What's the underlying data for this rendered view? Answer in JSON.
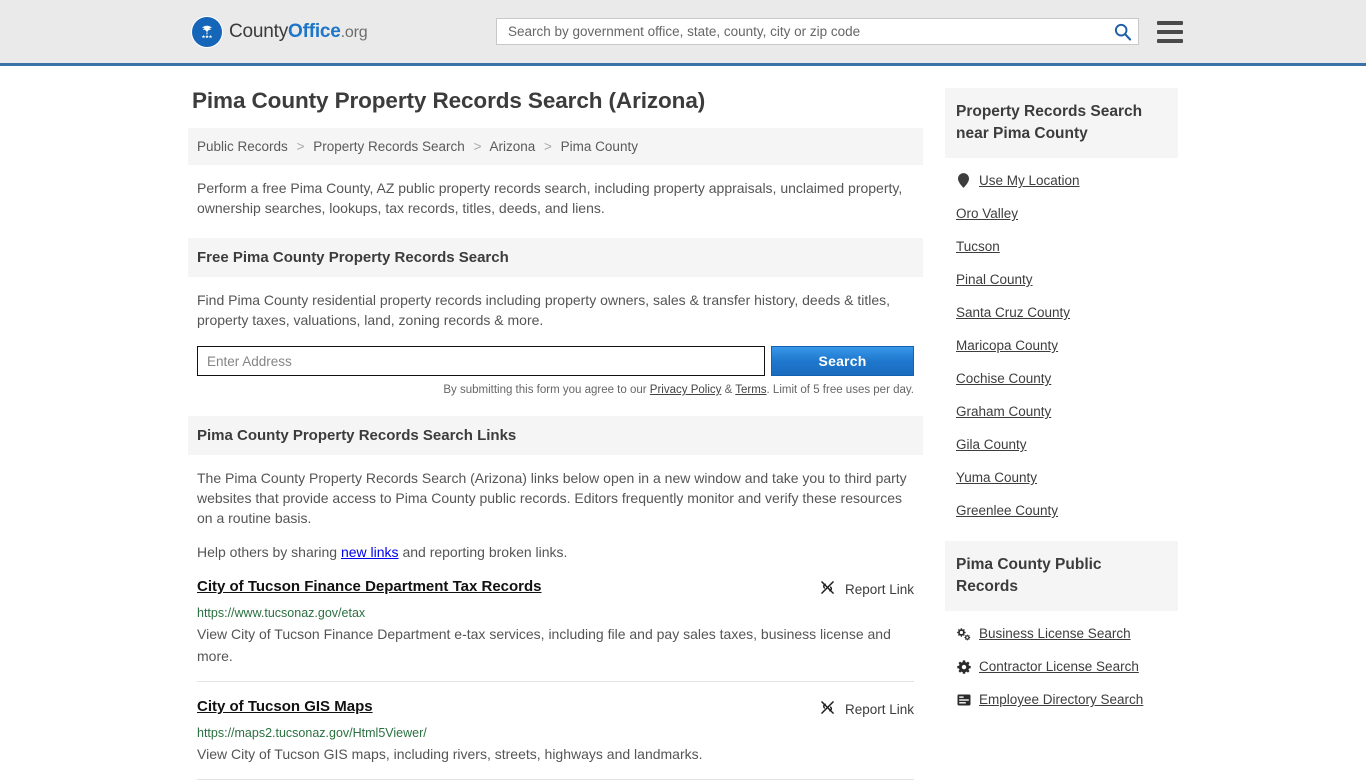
{
  "header": {
    "logo": {
      "part1": "County",
      "part2": "Office",
      "part3": ".org",
      "icon": "eagle-emblem-icon"
    },
    "search_placeholder": "Search by government office, state, county, city or zip code",
    "search_value": "",
    "search_icon": "search-icon",
    "menu_icon": "hamburger-menu-icon",
    "accent_color": "#3b72a5",
    "background_color": "#ebeaea"
  },
  "main": {
    "title": "Pima County Property Records Search (Arizona)",
    "breadcrumb": [
      "Public Records",
      "Property Records Search",
      "Arizona",
      "Pima County"
    ],
    "breadcrumb_separator": ">",
    "intro": "Perform a free Pima County, AZ public property records search, including property appraisals, unclaimed property, ownership searches, lookups, tax records, titles, deeds, and liens.",
    "free_search": {
      "heading": "Free Pima County Property Records Search",
      "description": "Find Pima County residential property records including property owners, sales & transfer history, deeds & titles, property taxes, valuations, land, zoning records & more.",
      "address_placeholder": "Enter Address",
      "address_value": "",
      "search_button": "Search",
      "disclaimer_prefix": "By submitting this form you agree to our ",
      "privacy_policy": "Privacy Policy",
      "disclaimer_amp": " & ",
      "terms": "Terms",
      "disclaimer_suffix": ". Limit of 5 free uses per day."
    },
    "links_section": {
      "heading": "Pima County Property Records Search Links",
      "paragraph": "The Pima County Property Records Search (Arizona) links below open in a new window and take you to third party websites that provide access to Pima County public records. Editors frequently monitor and verify these resources on a routine basis.",
      "share_prefix": "Help others by sharing ",
      "share_link": "new links",
      "share_suffix": " and reporting broken links.",
      "report_label": "Report Link",
      "report_icon": "broken-link-icon",
      "items": [
        {
          "title": "City of Tucson Finance Department Tax Records",
          "url": "https://www.tucsonaz.gov/etax",
          "description": "View City of Tucson Finance Department e-tax services, including file and pay sales taxes, business license and more."
        },
        {
          "title": "City of Tucson GIS Maps",
          "url": "https://maps2.tucsonaz.gov/Html5Viewer/",
          "description": "View City of Tucson GIS maps, including rivers, streets, highways and landmarks."
        }
      ]
    }
  },
  "sidebar": {
    "nearby": {
      "heading": "Property Records Search near Pima County",
      "items": [
        {
          "label": "Use My Location",
          "icon": "map-pin-icon"
        },
        {
          "label": "Oro Valley",
          "icon": ""
        },
        {
          "label": "Tucson",
          "icon": ""
        },
        {
          "label": "Pinal County",
          "icon": ""
        },
        {
          "label": "Santa Cruz County",
          "icon": ""
        },
        {
          "label": "Maricopa County",
          "icon": ""
        },
        {
          "label": "Cochise County",
          "icon": ""
        },
        {
          "label": "Graham County",
          "icon": ""
        },
        {
          "label": "Gila County",
          "icon": ""
        },
        {
          "label": "Yuma County",
          "icon": ""
        },
        {
          "label": "Greenlee County",
          "icon": ""
        }
      ]
    },
    "public_records": {
      "heading": "Pima County Public Records",
      "items": [
        {
          "label": "Business License Search",
          "icon": "cogs-icon"
        },
        {
          "label": "Contractor License Search",
          "icon": "cog-icon"
        },
        {
          "label": "Employee Directory Search",
          "icon": "address-card-icon"
        }
      ]
    }
  }
}
